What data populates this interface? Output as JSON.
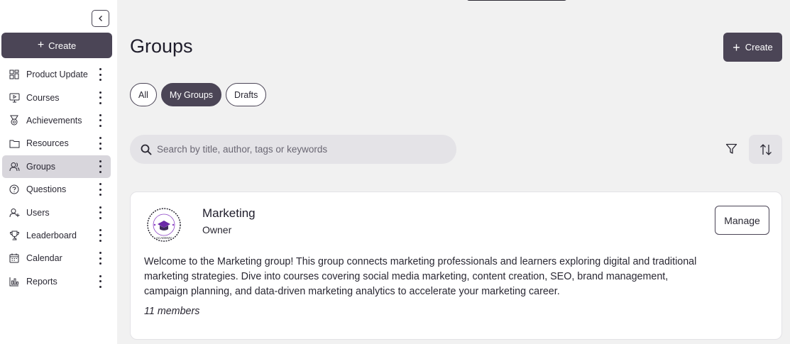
{
  "sidebar": {
    "create_label": "Create",
    "items": [
      {
        "label": "Product Update",
        "icon": "dashboard-icon"
      },
      {
        "label": "Courses",
        "icon": "monitor-play-icon"
      },
      {
        "label": "Achievements",
        "icon": "medal-icon"
      },
      {
        "label": "Resources",
        "icon": "folder-icon"
      },
      {
        "label": "Groups",
        "icon": "users-icon",
        "active": true
      },
      {
        "label": "Questions",
        "icon": "question-circle-icon"
      },
      {
        "label": "Users",
        "icon": "user-plus-icon"
      },
      {
        "label": "Leaderboard",
        "icon": "trophy-icon"
      },
      {
        "label": "Calendar",
        "icon": "calendar-icon"
      },
      {
        "label": "Reports",
        "icon": "bar-chart-icon"
      }
    ]
  },
  "header": {
    "title": "Groups",
    "create_label": "Create"
  },
  "tabs": [
    {
      "label": "All",
      "active": false
    },
    {
      "label": "My Groups",
      "active": true
    },
    {
      "label": "Drafts",
      "active": false
    }
  ],
  "search": {
    "placeholder": "Search by title, author, tags or keywords",
    "value": ""
  },
  "group_card": {
    "title": "Marketing",
    "role": "Owner",
    "manage_label": "Manage",
    "logo_text": "ACADEMY",
    "description": "Welcome to the Marketing group! This group connects marketing professionals and learners exploring digital and traditional marketing strategies. Dive into courses covering social media marketing, content creation, SEO, brand management, campaign planning, and data-driven marketing analytics to accelerate your marketing career.",
    "members": "11 members"
  },
  "colors": {
    "accent": "#4b4556",
    "background": "#f1f1f1",
    "active_nav": "#d8d6dc"
  }
}
